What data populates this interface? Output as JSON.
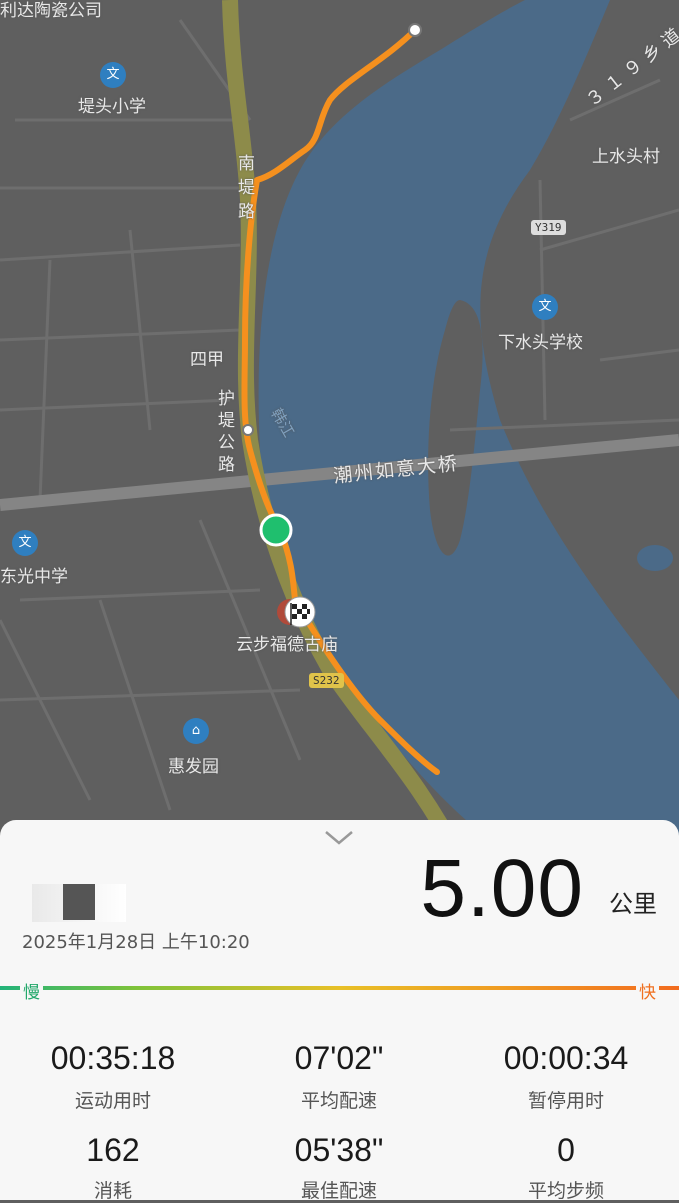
{
  "map": {
    "labels": {
      "company": "利达陶瓷公司",
      "school1": "堤头小学",
      "road_south": "南堤路",
      "siji": "四甲",
      "road_protect": "护堤公路",
      "river": "韩江",
      "bridge": "潮州如意大桥",
      "village": "上水头村",
      "school2": "下水头学校",
      "road_319": "３１９乡道",
      "school3": "东光中学",
      "temple": "云步福德古庙",
      "garden": "惠发园",
      "shield_y319": "Y319",
      "shield_s232": "S232"
    },
    "icons": {
      "poi": "school-icon",
      "garden": "residential-icon",
      "finish": "checkered-flag-icon",
      "current": "current-position-icon"
    }
  },
  "summary": {
    "distance": "5.00",
    "unit": "公里",
    "datetime": "2025年1月28日 上午10:20",
    "pace_scale": {
      "slow": "慢",
      "fast": "快"
    }
  },
  "stats": [
    {
      "value": "00:35:18",
      "label": "运动用时"
    },
    {
      "value": "07'02\"",
      "label": "平均配速"
    },
    {
      "value": "00:00:34",
      "label": "暂停用时"
    },
    {
      "value": "162",
      "label": "消耗"
    },
    {
      "value": "05'38\"",
      "label": "最佳配速"
    },
    {
      "value": "0",
      "label": "平均步频"
    }
  ],
  "colors": {
    "river": "#4b6a88",
    "land": "#5f5f5f",
    "route": "#f5901e",
    "current": "#1fbf6e"
  }
}
